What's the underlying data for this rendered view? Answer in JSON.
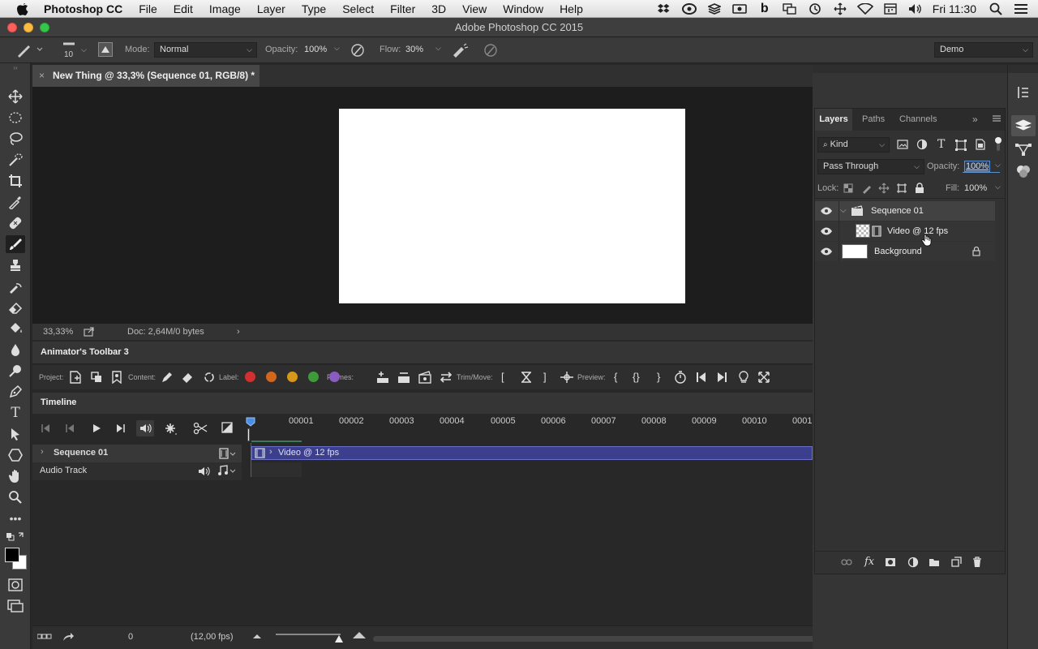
{
  "menubar": {
    "app_name": "Photoshop CC",
    "items": [
      "File",
      "Edit",
      "Image",
      "Layer",
      "Type",
      "Select",
      "Filter",
      "3D",
      "View",
      "Window",
      "Help"
    ],
    "clock": "Fri 11:30"
  },
  "window": {
    "title": "Adobe Photoshop CC 2015"
  },
  "options": {
    "brush_size": "10",
    "mode_label": "Mode:",
    "mode_value": "Normal",
    "opacity_label": "Opacity:",
    "opacity_value": "100%",
    "flow_label": "Flow:",
    "flow_value": "30%",
    "workspace": "Demo"
  },
  "document": {
    "tab_title": "New Thing @ 33,3% (Sequence 01, RGB/8) *",
    "zoom": "33,33%",
    "doc_info": "Doc: 2,64M/0 bytes",
    "canvas_color": "#ffffff"
  },
  "animator": {
    "title": "Animator's Toolbar 3",
    "project_label": "Project:",
    "content_label": "Content:",
    "label_label": "Label:",
    "label_colors": [
      "#d0302f",
      "#d2661c",
      "#d6971a",
      "#3e9a3a",
      "#8b5cc0"
    ],
    "frames_label": "Frames:",
    "trim_label": "Trim/Move:",
    "preview_label": "Preview:"
  },
  "timeline": {
    "title": "Timeline",
    "frames": [
      "00001",
      "00002",
      "00003",
      "00004",
      "00005",
      "00006",
      "00007",
      "00008",
      "00009",
      "00010",
      "0001"
    ],
    "tracks": {
      "sequence": "Sequence 01",
      "audio": "Audio Track"
    },
    "clip_label": "Video @ 12 fps",
    "current_frame": "0",
    "fps": "(12,00 fps)"
  },
  "layers_panel": {
    "tabs": [
      "Layers",
      "Paths",
      "Channels"
    ],
    "filter_kind": "Kind",
    "blend_mode": "Pass Through",
    "opacity_label": "Opacity:",
    "opacity_value": "100%",
    "lock_label": "Lock:",
    "fill_label": "Fill:",
    "fill_value": "100%",
    "layers": [
      {
        "name": "Sequence 01",
        "type": "group"
      },
      {
        "name": "Video @ 12 fps",
        "type": "video"
      },
      {
        "name": "Background",
        "type": "background"
      }
    ]
  }
}
